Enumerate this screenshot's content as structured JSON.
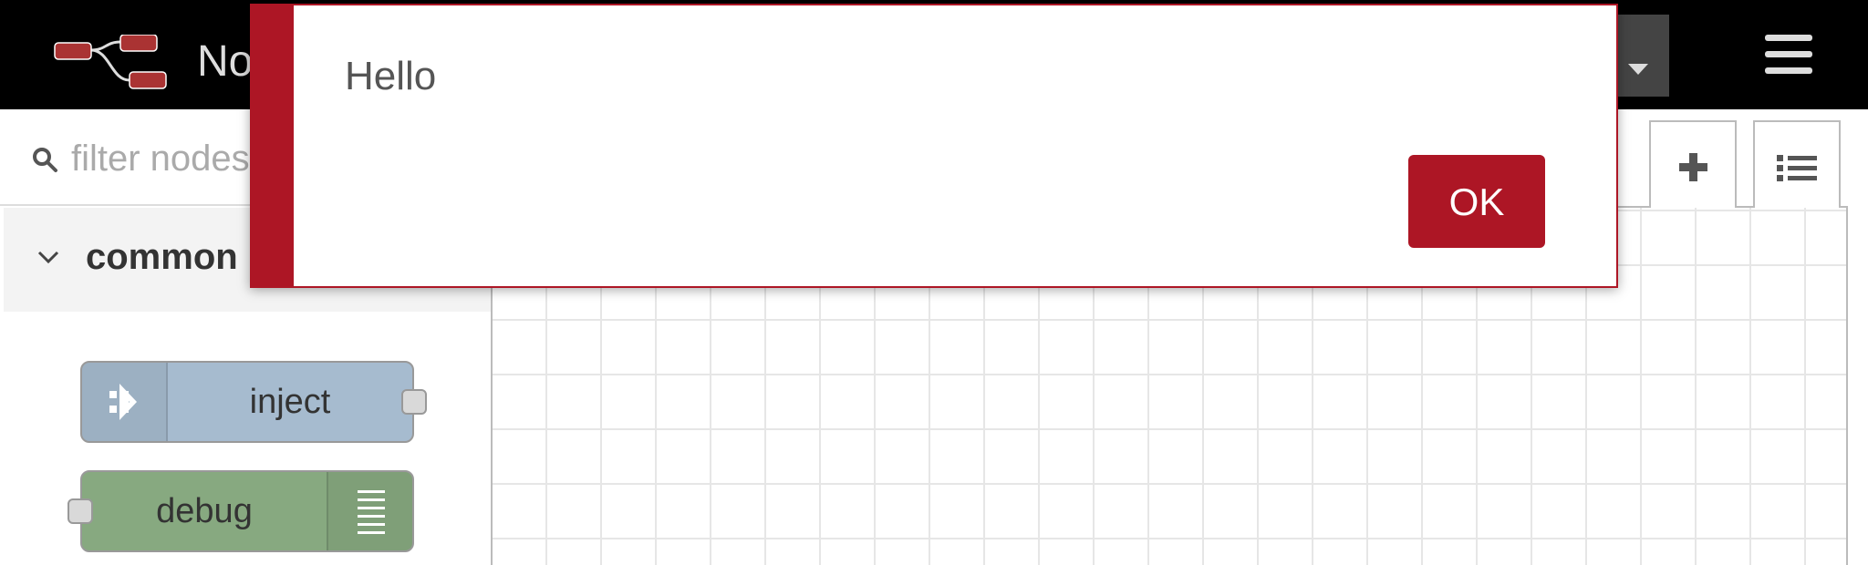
{
  "app": {
    "title": "Node-RED"
  },
  "header": {
    "logo_icon": "node-red-logo-icon",
    "deploy_dropdown_icon": "caret-down-icon",
    "menu_icon": "hamburger-menu-icon"
  },
  "palette": {
    "search": {
      "placeholder": "filter nodes",
      "value": "",
      "icon": "search-icon"
    },
    "categories": [
      {
        "label": "common",
        "expanded": true,
        "nodes": [
          {
            "label": "inject",
            "color": "#a6bbcf",
            "icon": "inject-arrow-icon"
          },
          {
            "label": "debug",
            "color": "#87a980",
            "icon": "debug-list-icon"
          }
        ]
      }
    ]
  },
  "workspace": {
    "tab_buttons": [
      {
        "icon": "plus-icon"
      },
      {
        "icon": "list-icon"
      }
    ]
  },
  "notification": {
    "message": "Hello",
    "ok_label": "OK",
    "accent_color": "#ad1625"
  }
}
